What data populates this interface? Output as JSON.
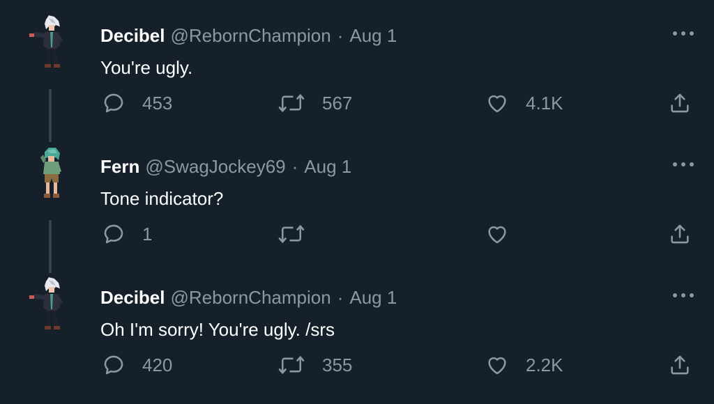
{
  "thread": {
    "tweets": [
      {
        "author": "Decibel",
        "handle": "@RebornChampion",
        "separator": "·",
        "date": "Aug 1",
        "text": "You're ugly.",
        "replies": "453",
        "retweets": "567",
        "likes": "4.1K",
        "avatar_icon": "pixel-trainer-sprite-white-hair"
      },
      {
        "author": "Fern",
        "handle": "@SwagJockey69",
        "separator": "·",
        "date": "Aug 1",
        "text": "Tone indicator?",
        "replies": "1",
        "retweets": "",
        "likes": "",
        "avatar_icon": "pixel-trainer-sprite-green-hair"
      },
      {
        "author": "Decibel",
        "handle": "@RebornChampion",
        "separator": "·",
        "date": "Aug 1",
        "text": "Oh I'm sorry! You're ugly. /srs",
        "replies": "420",
        "retweets": "355",
        "likes": "2.2K",
        "avatar_icon": "pixel-trainer-sprite-white-hair"
      }
    ]
  },
  "colors": {
    "background": "#15202b",
    "text_primary": "#ffffff",
    "text_secondary": "#8b98a5",
    "thread_line": "#38444d"
  }
}
